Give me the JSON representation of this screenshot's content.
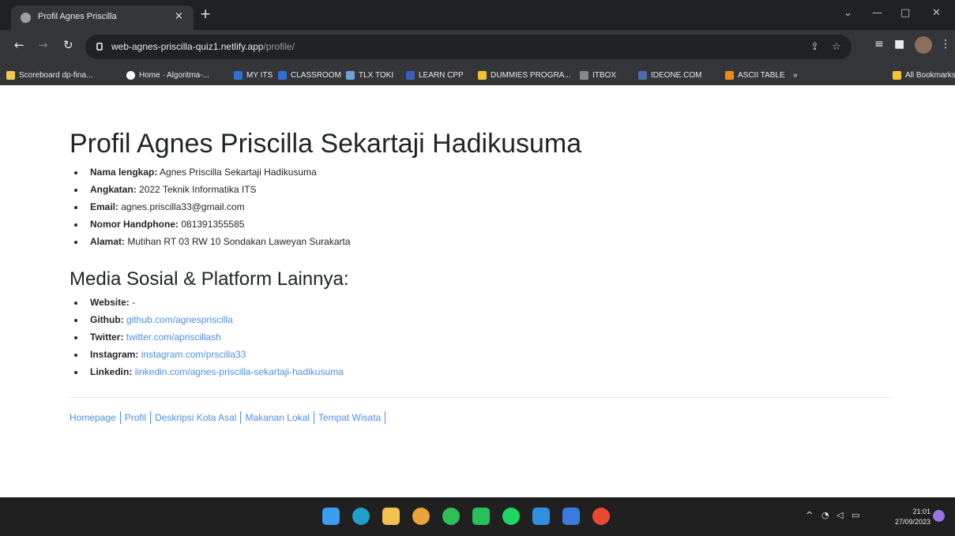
{
  "browser": {
    "tab_title": "Profil Agnes Priscilla",
    "tab_close": "×",
    "new_tab": "+",
    "url_host": "web-agnes-priscilla-quiz1.netlify.app",
    "url_path": "/profile/",
    "bookmarks": [
      {
        "label": "Scoreboard dp-fina...",
        "color": "#f2c94c"
      },
      {
        "label": "Home · Algoritma-...",
        "color": "#ffffff"
      },
      {
        "label": "MY ITS",
        "color": "#2f6fd6"
      },
      {
        "label": "CLASSROOM",
        "color": "#2f6fd6"
      },
      {
        "label": "TLX TOKI",
        "color": "#6fa0d8"
      },
      {
        "label": "LEARN CPP",
        "color": "#3a5fb8"
      },
      {
        "label": "DUMMIES PROGRA...",
        "color": "#f4c430"
      },
      {
        "label": "ITBOX",
        "color": "#888888"
      },
      {
        "label": "IDEONE.COM",
        "color": "#4a6fa5"
      },
      {
        "label": "ASCII TABLE",
        "color": "#e88a1a"
      },
      {
        "label": "All Bookmarks",
        "color": "#f4c430"
      }
    ]
  },
  "page": {
    "title": "Profil Agnes Priscilla Sekartaji Hadikusuma",
    "profile": [
      {
        "label": "Nama lengkap:",
        "value": "Agnes Priscilla Sekartaji Hadikusuma"
      },
      {
        "label": "Angkatan:",
        "value": "2022 Teknik Informatika ITS"
      },
      {
        "label": "Email:",
        "value": "agnes.priscilla33@gmail.com"
      },
      {
        "label": "Nomor Handphone:",
        "value": "081391355585"
      },
      {
        "label": "Alamat:",
        "value": "Mutihan RT 03 RW 10 Sondakan Laweyan Surakarta"
      }
    ],
    "social_title": "Media Sosial & Platform Lainnya:",
    "social": [
      {
        "label": "Website:",
        "value": "-"
      },
      {
        "label": "Github:",
        "value": "github.com/agnespriscilla"
      },
      {
        "label": "Twitter:",
        "value": "twitter.com/apriscillash"
      },
      {
        "label": "Instagram:",
        "value": "instagram.com/prscilla33"
      },
      {
        "label": "Linkedin:",
        "value": "linkedin.com/agnes-priscilla-sekartaji-hadikusuma"
      }
    ],
    "footer_nav": [
      "Homepage",
      "Profil",
      "Deskripsi Kota Asal",
      "Makanan Lokal",
      "Tempat Wisata"
    ]
  },
  "taskbar": {
    "time": "21:01",
    "date": "27/09/2023",
    "apps": [
      {
        "name": "windows-start-icon",
        "color": "#3b9cf0"
      },
      {
        "name": "edge-icon",
        "color": "#1fa0c8"
      },
      {
        "name": "file-explorer-icon",
        "color": "#f2c14e"
      },
      {
        "name": "chrome-icon",
        "color": "#e8a33a"
      },
      {
        "name": "whatsapp-icon",
        "color": "#2fbf56"
      },
      {
        "name": "line-icon",
        "color": "#28c05a"
      },
      {
        "name": "spotify-icon",
        "color": "#1ed760"
      },
      {
        "name": "vscode-icon",
        "color": "#2f8fe0"
      },
      {
        "name": "store-icon",
        "color": "#3a7be0"
      },
      {
        "name": "app-icon",
        "color": "#e84a2f"
      }
    ]
  }
}
